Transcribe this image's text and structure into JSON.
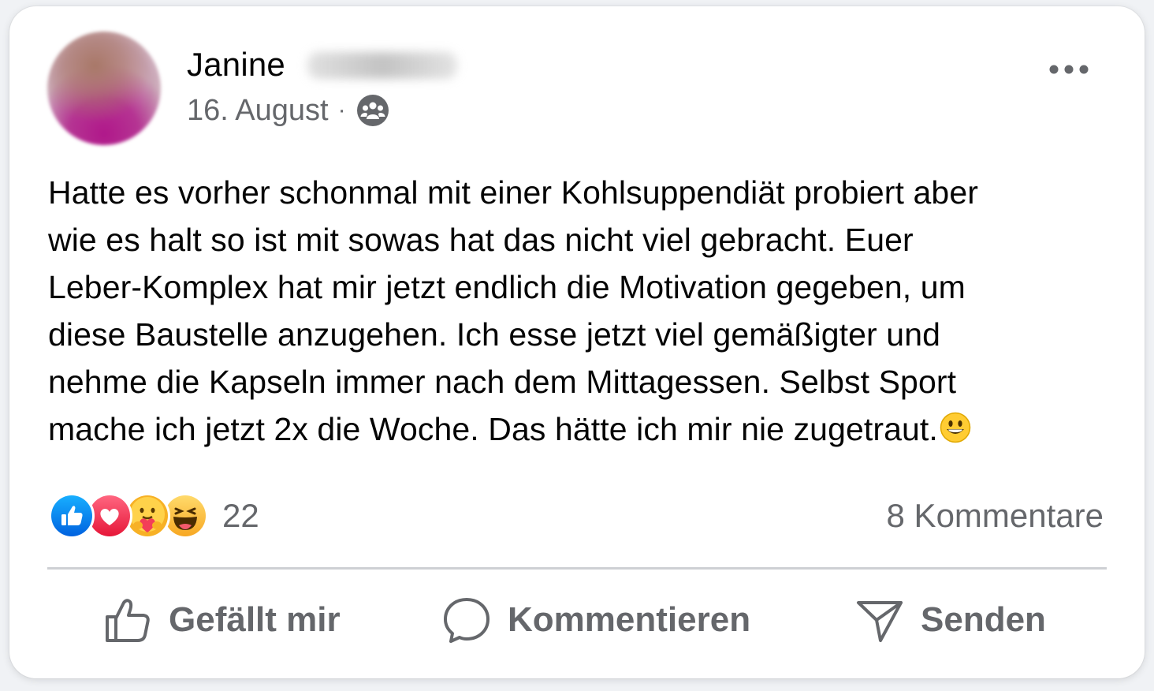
{
  "post": {
    "author_first_name": "Janine",
    "date": "16. August",
    "separator": "·",
    "audience_icon": "group-icon",
    "more_icon": "more-horizontal-icon",
    "text": "Hatte es vorher schonmal mit einer Kohlsuppendiät probiert aber\nwie es halt so ist mit sowas hat das nicht viel gebracht. Euer\nLeber-Komplex hat mir jetzt endlich die Motivation gegeben, um\ndiese Baustelle anzugehen. Ich esse jetzt viel gemäßigter und\nnehme die Kapseln immer nach dem Mittagessen. Selbst Sport\nmache ich jetzt 2x die Woche. Das hätte ich mir nie zugetraut.",
    "text_trailing_emoji": "smiley-emoji"
  },
  "stats": {
    "reactions": [
      "like-reaction",
      "love-reaction",
      "care-reaction",
      "haha-reaction"
    ],
    "reaction_count": "22",
    "comments": "8 Kommentare"
  },
  "actions": {
    "like_label": "Gefällt mir",
    "comment_label": "Kommentieren",
    "send_label": "Senden"
  },
  "colors": {
    "text_primary": "#050505",
    "text_secondary": "#65676b",
    "like_blue": "#1877f2",
    "love_red": "#f33e58",
    "divider": "#ced0d4"
  }
}
